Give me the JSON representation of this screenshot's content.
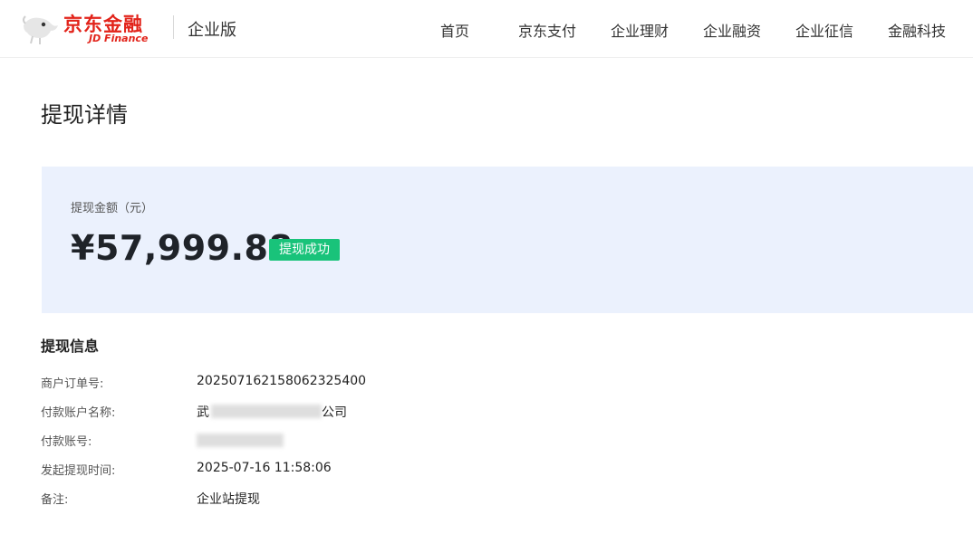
{
  "header": {
    "logo_cn": "京东金融",
    "logo_en": "JD Finance",
    "edition": "企业版",
    "nav": [
      {
        "label": "首页"
      },
      {
        "label": "京东支付"
      },
      {
        "label": "企业理财"
      },
      {
        "label": "企业融资"
      },
      {
        "label": "企业征信"
      },
      {
        "label": "金融科技"
      }
    ]
  },
  "page": {
    "title": "提现详情"
  },
  "amount": {
    "label": "提现金额（元）",
    "value": "¥57,999.88",
    "status": "提现成功",
    "status_color": "#19c37a",
    "card_bg": "#ebf1fd"
  },
  "info": {
    "section_title": "提现信息",
    "rows": [
      {
        "label": "商户订单号:",
        "value": "20250716215806232540​0"
      },
      {
        "label": "付款账户名称:",
        "value_prefix": "武",
        "value_suffix": "公司"
      },
      {
        "label": "付款账号:",
        "value": ""
      },
      {
        "label": "发起提现时间:",
        "value": "2025-07-16 11:58:06"
      },
      {
        "label": "备注:",
        "value": "企业站提现"
      }
    ]
  },
  "brand_color": "#e2231a"
}
